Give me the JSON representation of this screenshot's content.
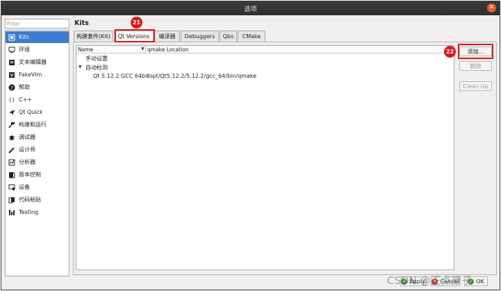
{
  "window": {
    "title": "选项"
  },
  "filter": {
    "placeholder": "Filter"
  },
  "sidebar": {
    "items": [
      {
        "label": "Kits",
        "icon": "kits-icon",
        "selected": true
      },
      {
        "label": "环境",
        "icon": "monitor-icon"
      },
      {
        "label": "文本编辑器",
        "icon": "text-editor-icon"
      },
      {
        "label": "FakeVim",
        "icon": "fakevim-icon"
      },
      {
        "label": "帮助",
        "icon": "help-icon"
      },
      {
        "label": "C++",
        "icon": "cpp-icon"
      },
      {
        "label": "Qt Quick",
        "icon": "qtquick-icon"
      },
      {
        "label": "构建和运行",
        "icon": "hammer-icon"
      },
      {
        "label": "调试器",
        "icon": "bug-icon"
      },
      {
        "label": "设计师",
        "icon": "pen-icon"
      },
      {
        "label": "分析器",
        "icon": "analyzer-icon"
      },
      {
        "label": "版本控制",
        "icon": "version-control-icon"
      },
      {
        "label": "设备",
        "icon": "device-icon"
      },
      {
        "label": "代码粘贴",
        "icon": "code-paste-icon"
      },
      {
        "label": "Testing",
        "icon": "testing-icon"
      }
    ]
  },
  "page": {
    "title": "Kits"
  },
  "tabs": [
    {
      "label": "构建套件(Kit)"
    },
    {
      "label": "Qt Versions",
      "active": true
    },
    {
      "label": "编译器"
    },
    {
      "label": "Debuggers"
    },
    {
      "label": "Qbs"
    },
    {
      "label": "CMake"
    }
  ],
  "tree": {
    "columns": {
      "name": "Name",
      "qmake": "qmake Location"
    },
    "rows": {
      "manual": "手动设置",
      "auto": "自动检测",
      "qt_name": "Qt 5.12.2 GCC 64bit",
      "qt_path": "/opt/Qt5.12.2/5.12.2/gcc_64/bin/qmake"
    }
  },
  "buttons": {
    "add": "添加...",
    "remove": "删除",
    "cleanup": "Clean Up",
    "apply": "Apply",
    "cancel": "Cancel",
    "ok": "OK"
  },
  "annotations": {
    "tab_badge": "21",
    "add_badge": "22"
  },
  "watermark": "CSDN @正点原子",
  "colors": {
    "selection": "#3f7bd0",
    "callout": "#d61a1a",
    "close": "#e65b2e"
  }
}
